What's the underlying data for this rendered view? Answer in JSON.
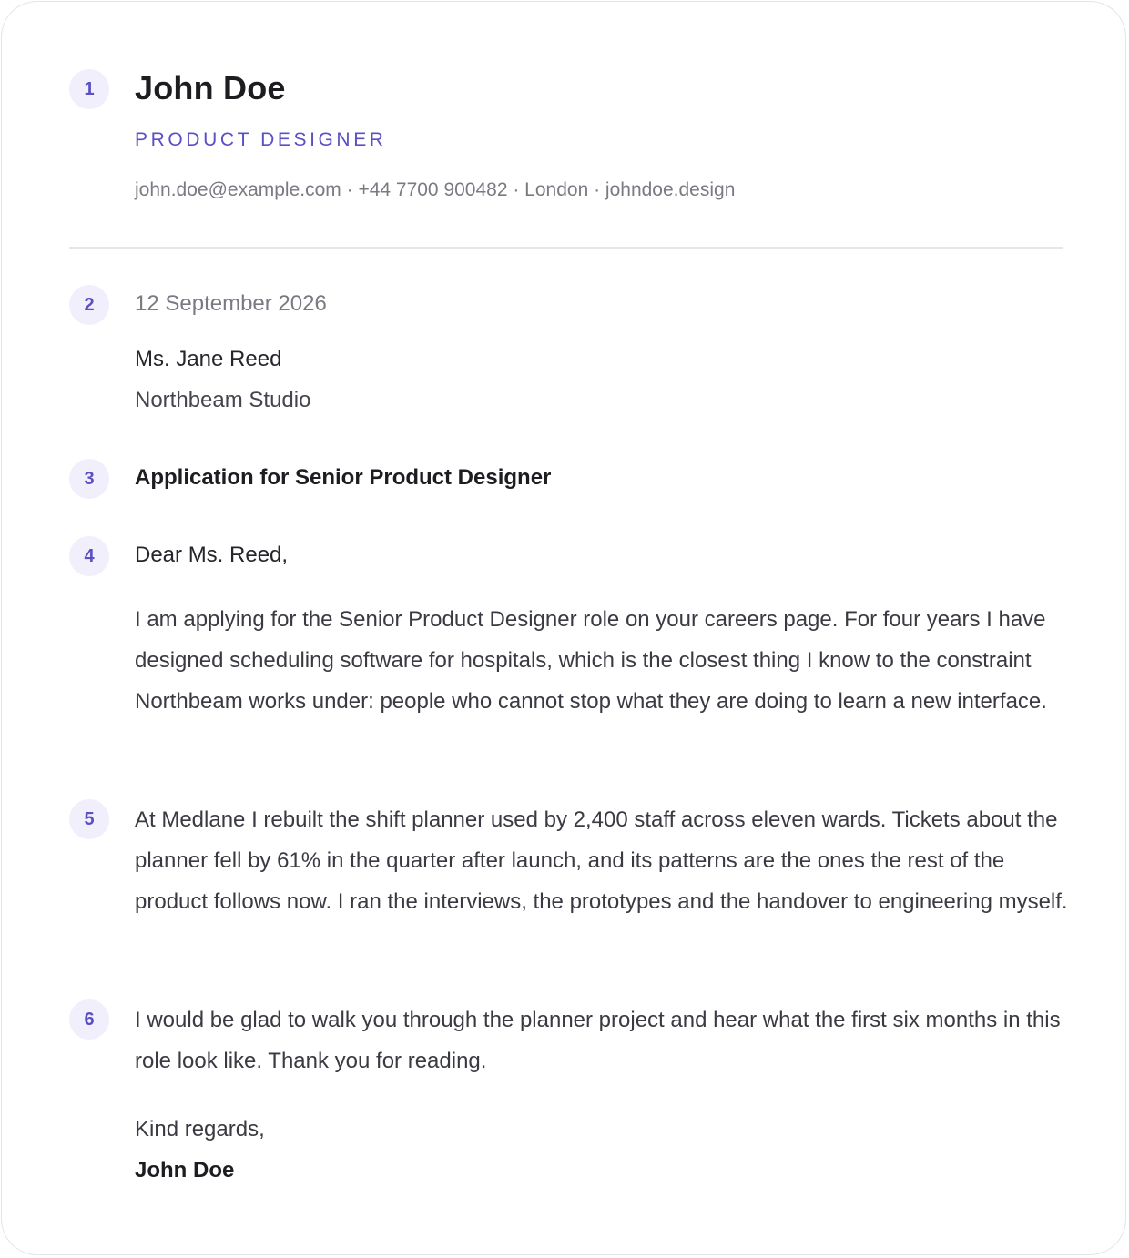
{
  "header": {
    "marker": "1",
    "name": "John Doe",
    "role": "PRODUCT DESIGNER",
    "contact": "john.doe@example.com · +44 7700 900482 · London · johndoe.design"
  },
  "meta": {
    "marker": "2",
    "date": "12 September 2026",
    "recipient_name": "Ms. Jane Reed",
    "recipient_company": "Northbeam Studio"
  },
  "subject": {
    "marker": "3",
    "text": "Application for Senior Product Designer"
  },
  "body": {
    "greeting_marker": "4",
    "greeting": "Dear Ms. Reed,",
    "paragraphs": [
      {
        "text": "I am applying for the Senior Product Designer role on your careers page. For four years I have designed scheduling software for hospitals, which is the closest thing I know to the constraint Northbeam works under: people who cannot stop what they are doing to learn a new interface."
      },
      {
        "marker": "5",
        "text": "At Medlane I rebuilt the shift planner used by 2,400 staff across eleven wards. Tickets about the planner fell by 61% in the quarter after launch, and its patterns are the ones the rest of the product follows now. I ran the interviews, the prototypes and the handover to engineering myself."
      },
      {
        "marker": "6",
        "text": "I would be glad to walk you through the planner project and hear what the first six months in this role look like. Thank you for reading."
      }
    ]
  },
  "signoff": {
    "closing": "Kind regards,",
    "signature": "John Doe"
  }
}
